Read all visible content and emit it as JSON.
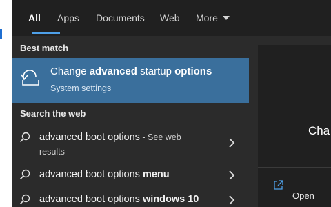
{
  "tabs": [
    {
      "label": "All",
      "active": true
    },
    {
      "label": "Apps"
    },
    {
      "label": "Documents"
    },
    {
      "label": "Web"
    },
    {
      "label": "More"
    }
  ],
  "best_match": {
    "section_title": "Best match",
    "title_parts": [
      "Change ",
      "advanced",
      " startup ",
      "options"
    ],
    "subtitle": "System settings",
    "icon": "startup-recovery-icon"
  },
  "web": {
    "section_title": "Search the web",
    "results": [
      {
        "plain": "advanced boot options",
        "sep": " - ",
        "see_web": "See web",
        "extra": "results",
        "bold": ""
      },
      {
        "plain": "advanced boot options ",
        "bold": "menu"
      },
      {
        "plain": "advanced boot options ",
        "bold": "windows 10"
      }
    ]
  },
  "preview": {
    "title_fragment": "Cha",
    "open_label": "Open"
  },
  "colors": {
    "highlight": "#3a6f9c",
    "accent": "#4ea0e8",
    "panel": "#2b2b2b"
  }
}
